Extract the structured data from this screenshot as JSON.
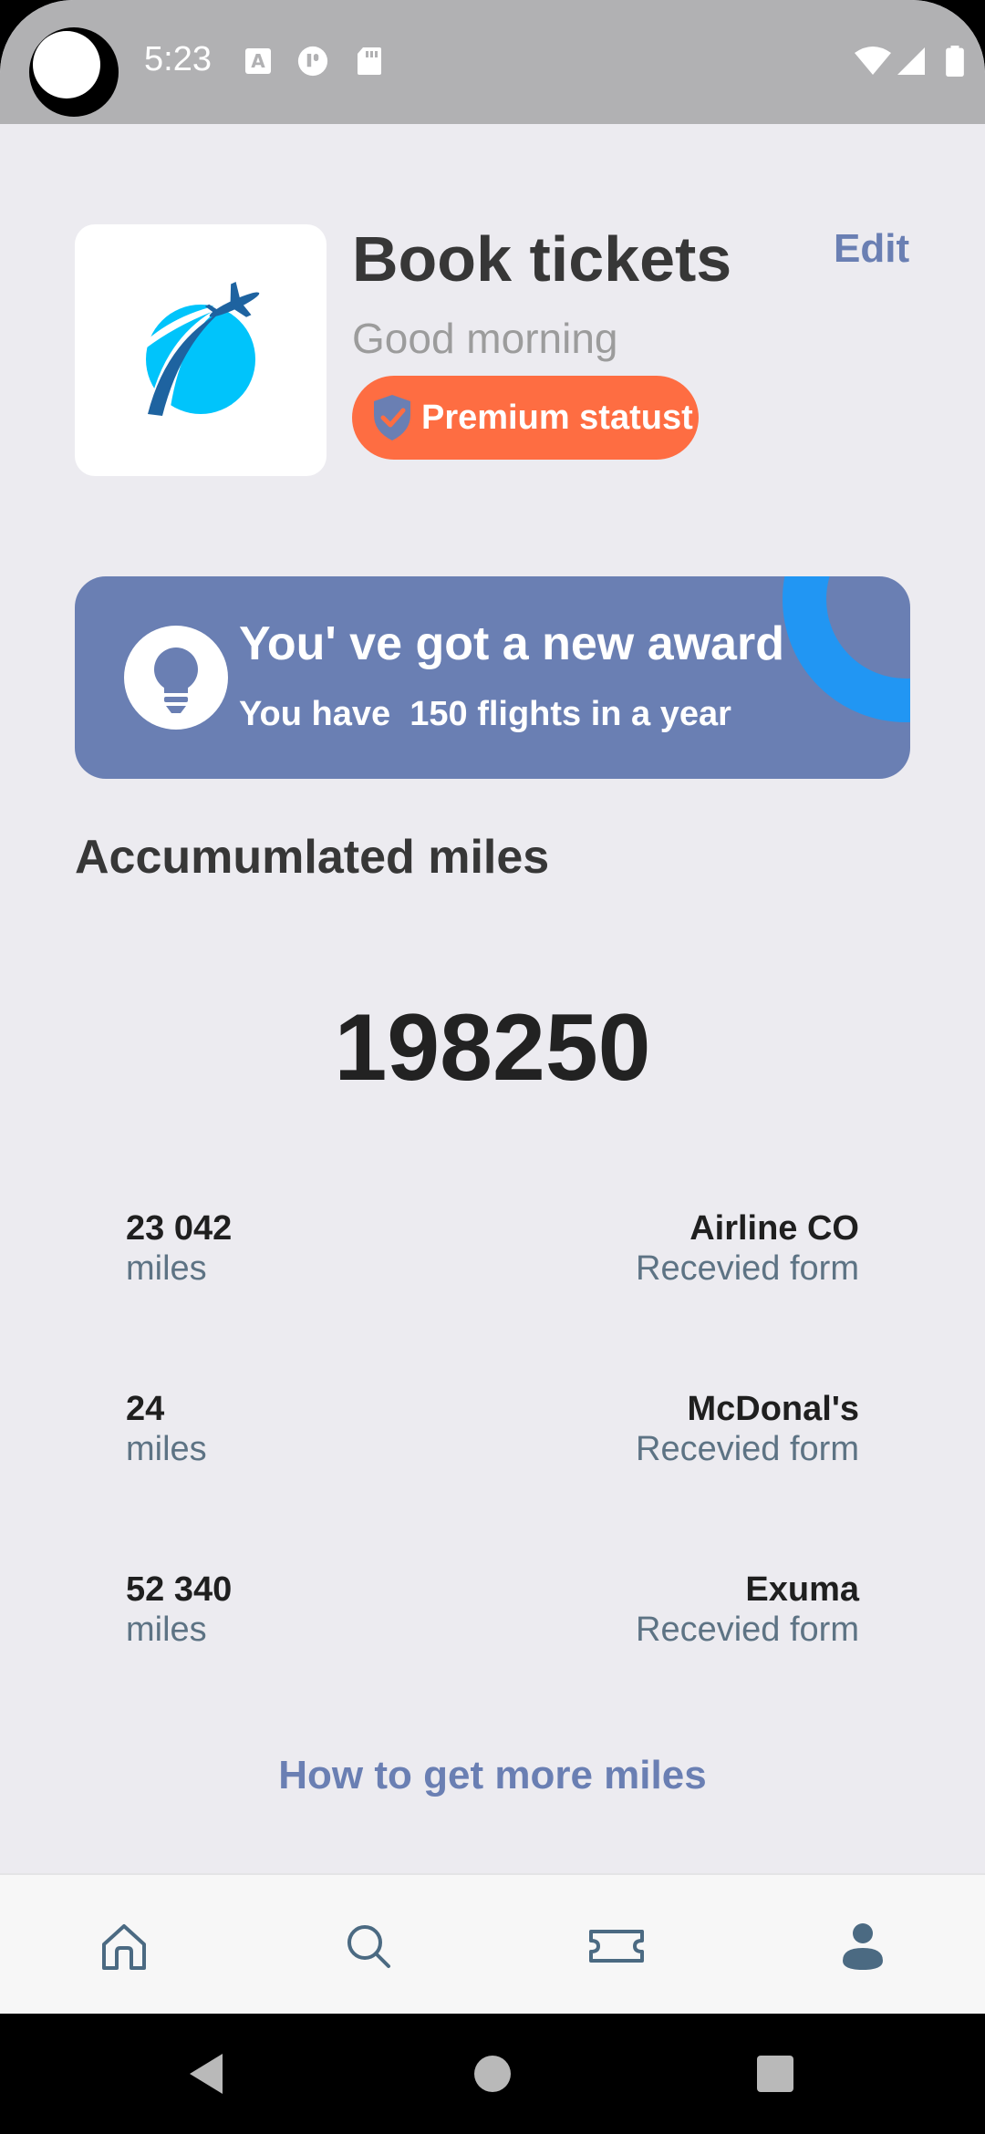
{
  "status_bar": {
    "time": "5:23"
  },
  "header": {
    "title": "Book tickets",
    "greeting": "Good morning",
    "edit_label": "Edit",
    "badge_label": "Premium statust"
  },
  "award": {
    "title": "You' ve got a new award",
    "subtitle": "You have  150 flights in a year"
  },
  "miles": {
    "section_title": "Accumumlated miles",
    "total": "198250",
    "entries": [
      {
        "amount": "23 042",
        "unit": "miles",
        "source": "Airline CO",
        "received": "Recevied form"
      },
      {
        "amount": "24",
        "unit": "miles",
        "source": "McDonal's",
        "received": "Recevied form"
      },
      {
        "amount": "52 340",
        "unit": "miles",
        "source": "Exuma",
        "received": "Recevied form"
      }
    ],
    "more_link": "How to get more miles"
  },
  "tabs": [
    {
      "icon": "home-icon"
    },
    {
      "icon": "search-icon"
    },
    {
      "icon": "ticket-icon"
    },
    {
      "icon": "profile-icon"
    }
  ],
  "colors": {
    "accent": "#6a7fb3",
    "badge": "#fe6d42",
    "award_ring": "#2196f3",
    "background": "#ecebf0"
  }
}
